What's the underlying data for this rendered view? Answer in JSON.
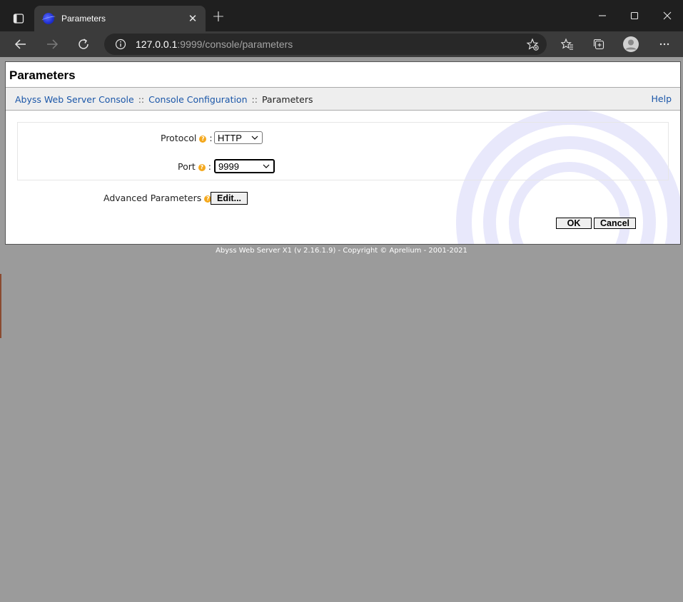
{
  "browser": {
    "tab_title": "Parameters",
    "address_host": "127.0.0.1",
    "address_path": ":9999/console/parameters"
  },
  "page": {
    "title": "Parameters",
    "breadcrumbs": [
      "Abyss Web Server Console",
      "Console Configuration",
      "Parameters"
    ],
    "breadcrumb_separator": "::",
    "help_label": "Help",
    "fields": {
      "protocol_label": "Protocol",
      "protocol_value": "HTTP",
      "port_label": "Port",
      "port_value": "9999",
      "advanced_label": "Advanced Parameters",
      "edit_label": "Edit..."
    },
    "help_marker": "?",
    "colon": ":",
    "ok_label": "OK",
    "cancel_label": "Cancel"
  },
  "footer": "Abyss Web Server X1 (v 2.16.1.9) - Copyright © Aprelium - 2001-2021",
  "colors": {
    "link": "#1a56a8",
    "chrome_dark": "#1f1f1f",
    "chrome_toolbar": "#3b3b3b",
    "page_background": "#9b9b9b",
    "help_dot": "#f4a81d"
  },
  "icons": [
    "tab-actions-icon",
    "abyss-favicon",
    "close-icon",
    "plus-icon",
    "minimize-icon",
    "maximize-icon",
    "window-close-icon",
    "back-arrow-icon",
    "forward-arrow-icon",
    "refresh-icon",
    "info-icon",
    "add-favorite-icon",
    "favorites-icon",
    "collections-icon",
    "profile-icon",
    "more-icon",
    "chevron-down-icon",
    "help-icon"
  ]
}
